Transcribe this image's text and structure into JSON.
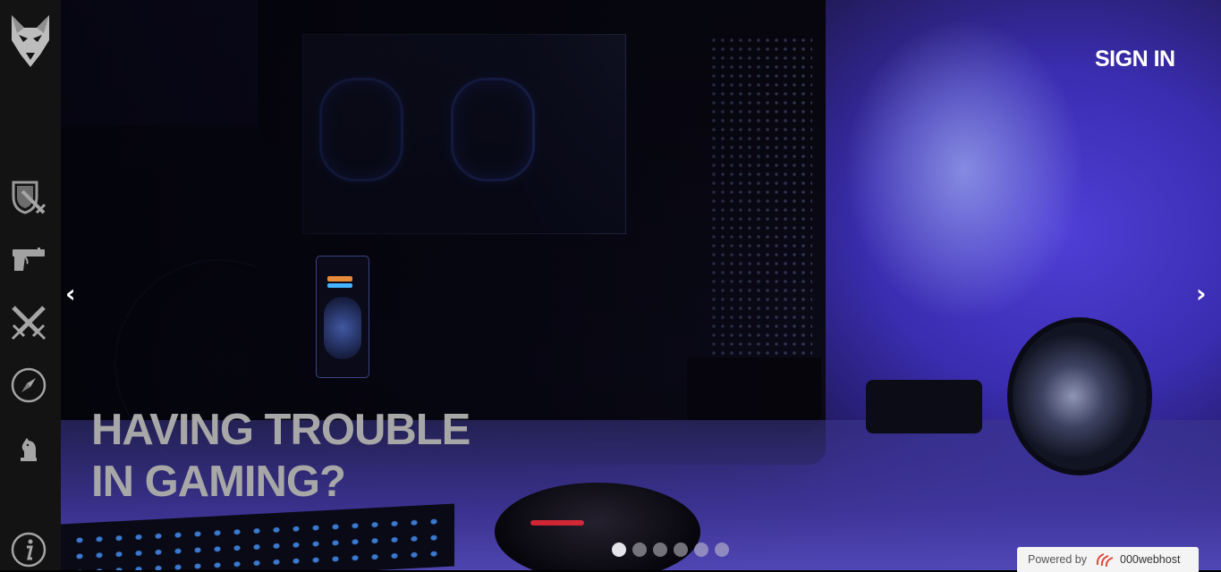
{
  "sidebar": {
    "logo": "wolf-logo",
    "items": [
      {
        "icon": "shield-sword-icon"
      },
      {
        "icon": "pistol-icon"
      },
      {
        "icon": "crossed-swords-icon"
      },
      {
        "icon": "compass-icon"
      },
      {
        "icon": "chess-knight-icon"
      }
    ],
    "info_icon": "info-icon"
  },
  "header": {
    "sign_in": "SIGN IN"
  },
  "hero": {
    "headline_line1": "HAVING TROUBLE",
    "headline_line2": "IN GAMING?",
    "prev_arrow": "‹",
    "next_arrow": "›",
    "slides_count": 6,
    "active_slide": 1
  },
  "footer_badge": {
    "prefix": "Powered by",
    "brand": "000webhost"
  },
  "colors": {
    "sidebar_bg": "#131313",
    "headline": "#a7a7a7",
    "sign_in": "#ffffff"
  }
}
